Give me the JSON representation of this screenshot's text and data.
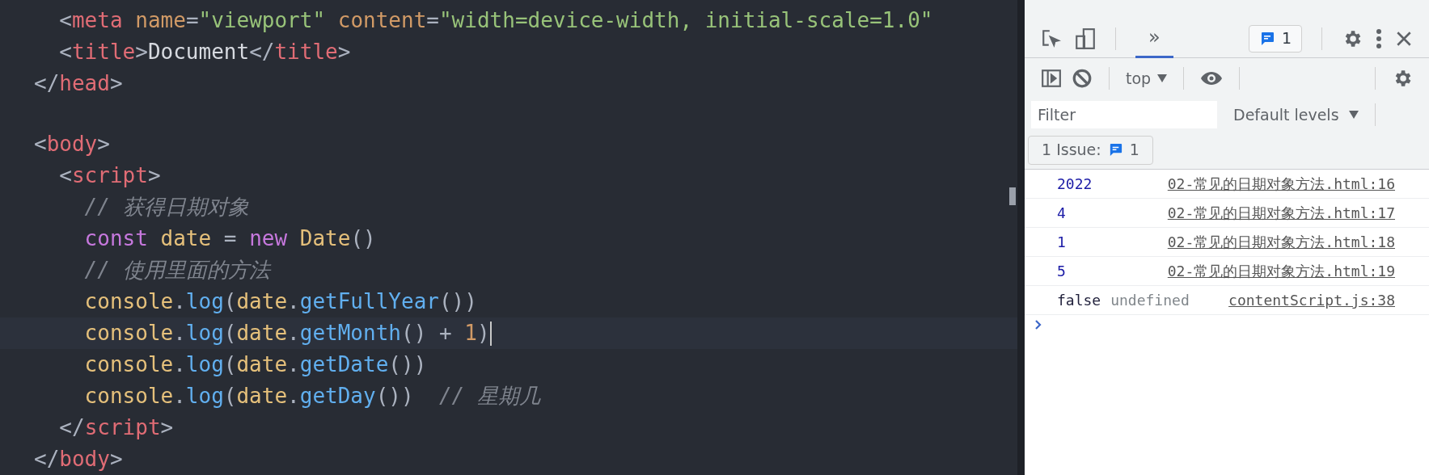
{
  "editor": {
    "lines": [
      {
        "current": false,
        "tokens": [
          {
            "kind": "punct",
            "text": "  <"
          },
          {
            "kind": "tag",
            "text": "meta"
          },
          {
            "kind": "attr",
            "text": " name"
          },
          {
            "kind": "punct",
            "text": "="
          },
          {
            "kind": "string",
            "text": "\"viewport\""
          },
          {
            "kind": "attr",
            "text": " content"
          },
          {
            "kind": "punct",
            "text": "="
          },
          {
            "kind": "string",
            "text": "\"width=device-width, initial-scale=1.0\""
          }
        ]
      },
      {
        "current": false,
        "tokens": [
          {
            "kind": "punct",
            "text": "  <"
          },
          {
            "kind": "tag",
            "text": "title"
          },
          {
            "kind": "punct",
            "text": ">"
          },
          {
            "kind": "text",
            "text": "Document"
          },
          {
            "kind": "punct",
            "text": "</"
          },
          {
            "kind": "tag",
            "text": "title"
          },
          {
            "kind": "punct",
            "text": ">"
          }
        ]
      },
      {
        "current": false,
        "tokens": [
          {
            "kind": "punct",
            "text": "</"
          },
          {
            "kind": "tag",
            "text": "head"
          },
          {
            "kind": "punct",
            "text": ">"
          }
        ]
      },
      {
        "current": false
      },
      {
        "current": false,
        "tokens": [
          {
            "kind": "punct",
            "text": "<"
          },
          {
            "kind": "tag",
            "text": "body"
          },
          {
            "kind": "punct",
            "text": ">"
          }
        ]
      },
      {
        "current": false,
        "tokens": [
          {
            "kind": "punct",
            "text": "  <"
          },
          {
            "kind": "tag",
            "text": "script"
          },
          {
            "kind": "punct",
            "text": ">"
          }
        ]
      },
      {
        "current": false,
        "tokens": [
          {
            "kind": "comment",
            "text": "    // 获得日期对象"
          }
        ]
      },
      {
        "current": false,
        "tokens": [
          {
            "kind": "keyword",
            "text": "    const"
          },
          {
            "kind": "var",
            "text": " date"
          },
          {
            "kind": "punct",
            "text": " = "
          },
          {
            "kind": "keyword",
            "text": "new"
          },
          {
            "kind": "class",
            "text": " Date"
          },
          {
            "kind": "punct",
            "text": "()"
          }
        ]
      },
      {
        "current": false,
        "tokens": [
          {
            "kind": "comment",
            "text": "    // 使用里面的方法"
          }
        ]
      },
      {
        "current": false,
        "tokens": [
          {
            "kind": "var",
            "text": "    console"
          },
          {
            "kind": "punct",
            "text": "."
          },
          {
            "kind": "fn",
            "text": "log"
          },
          {
            "kind": "punct",
            "text": "("
          },
          {
            "kind": "var",
            "text": "date"
          },
          {
            "kind": "punct",
            "text": "."
          },
          {
            "kind": "fn",
            "text": "getFullYear"
          },
          {
            "kind": "punct",
            "text": "())"
          }
        ]
      },
      {
        "current": true,
        "tokens": [
          {
            "kind": "var",
            "text": "    console"
          },
          {
            "kind": "punct",
            "text": "."
          },
          {
            "kind": "fn",
            "text": "log"
          },
          {
            "kind": "punct",
            "text": "("
          },
          {
            "kind": "var",
            "text": "date"
          },
          {
            "kind": "punct",
            "text": "."
          },
          {
            "kind": "fn",
            "text": "getMonth"
          },
          {
            "kind": "punct",
            "text": "() + "
          },
          {
            "kind": "number",
            "text": "1"
          },
          {
            "kind": "punct",
            "text": ")"
          }
        ]
      },
      {
        "current": false,
        "tokens": [
          {
            "kind": "var",
            "text": "    console"
          },
          {
            "kind": "punct",
            "text": "."
          },
          {
            "kind": "fn",
            "text": "log"
          },
          {
            "kind": "punct",
            "text": "("
          },
          {
            "kind": "var",
            "text": "date"
          },
          {
            "kind": "punct",
            "text": "."
          },
          {
            "kind": "fn",
            "text": "getDate"
          },
          {
            "kind": "punct",
            "text": "())"
          }
        ]
      },
      {
        "current": false,
        "tokens": [
          {
            "kind": "var",
            "text": "    console"
          },
          {
            "kind": "punct",
            "text": "."
          },
          {
            "kind": "fn",
            "text": "log"
          },
          {
            "kind": "punct",
            "text": "("
          },
          {
            "kind": "var",
            "text": "date"
          },
          {
            "kind": "punct",
            "text": "."
          },
          {
            "kind": "fn",
            "text": "getDay"
          },
          {
            "kind": "punct",
            "text": "())"
          },
          {
            "kind": "comment",
            "text": "  // 星期几"
          }
        ]
      },
      {
        "current": false,
        "tokens": [
          {
            "kind": "punct",
            "text": "  </"
          },
          {
            "kind": "tag",
            "text": "script"
          },
          {
            "kind": "punct",
            "text": ">"
          }
        ]
      },
      {
        "current": false,
        "tokens": [
          {
            "kind": "punct",
            "text": "</"
          },
          {
            "kind": "tag",
            "text": "body"
          },
          {
            "kind": "punct",
            "text": ">"
          }
        ]
      }
    ]
  },
  "devtools": {
    "tabs": [
      {
        "label": "»",
        "selected": true
      }
    ],
    "issues_badge": "1",
    "context": "top",
    "filter": {
      "placeholder": "Filter"
    },
    "levels": "Default levels",
    "issues": {
      "label": "1 Issue:",
      "count": "1"
    },
    "messages": [
      {
        "values": [
          {
            "kind": "number",
            "text": "2022"
          }
        ],
        "source": "02-常见的日期对象方法.html:16"
      },
      {
        "values": [
          {
            "kind": "number",
            "text": "4"
          }
        ],
        "source": "02-常见的日期对象方法.html:17"
      },
      {
        "values": [
          {
            "kind": "number",
            "text": "1"
          }
        ],
        "source": "02-常见的日期对象方法.html:18"
      },
      {
        "values": [
          {
            "kind": "number",
            "text": "5"
          }
        ],
        "source": "02-常见的日期对象方法.html:19"
      },
      {
        "values": [
          {
            "kind": "boolean",
            "text": "false"
          },
          {
            "kind": "undefined",
            "text": "undefined"
          }
        ],
        "source": "contentScript.js:38"
      }
    ]
  }
}
